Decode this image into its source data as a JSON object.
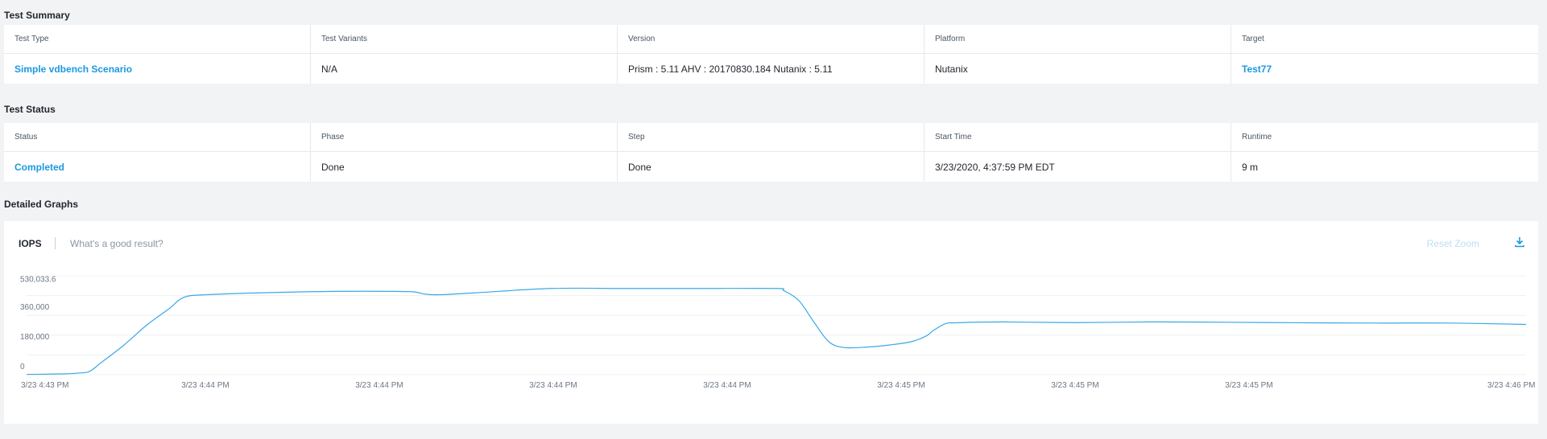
{
  "sections": {
    "summary_title": "Test Summary",
    "status_title": "Test Status",
    "graphs_title": "Detailed Graphs"
  },
  "summary": {
    "headers": [
      "Test Type",
      "Test Variants",
      "Version",
      "Platform",
      "Target"
    ],
    "values": [
      "Simple vdbench Scenario",
      "N/A",
      "Prism : 5.11 AHV : 20170830.184 Nutanix : 5.11",
      "Nutanix",
      "Test77"
    ]
  },
  "status": {
    "headers": [
      "Status",
      "Phase",
      "Step",
      "Start Time",
      "Runtime"
    ],
    "values": [
      "Completed",
      "Done",
      "Done",
      "3/23/2020, 4:37:59 PM EDT",
      "9 m"
    ]
  },
  "graph": {
    "tab_label": "IOPS",
    "help_link": "What's a good result?",
    "reset_zoom": "Reset Zoom",
    "download_icon": "download-icon",
    "line_color": "#3aa8e6"
  },
  "chart_data": {
    "type": "line",
    "yticks": [
      {
        "value": 0,
        "label": "0"
      },
      {
        "value": 180000,
        "label": "180,000"
      },
      {
        "value": 360000,
        "label": "360,000"
      },
      {
        "value": 530033.6,
        "label": "530,033.6"
      }
    ],
    "ylim": [
      0,
      600000
    ],
    "xticks": [
      {
        "x": 0.0,
        "label": "3/23 4:43 PM"
      },
      {
        "x": 0.107,
        "label": "3/23 4:44 PM"
      },
      {
        "x": 0.223,
        "label": "3/23 4:44 PM"
      },
      {
        "x": 0.339,
        "label": "3/23 4:44 PM"
      },
      {
        "x": 0.455,
        "label": "3/23 4:44 PM"
      },
      {
        "x": 0.571,
        "label": "3/23 4:45 PM"
      },
      {
        "x": 0.687,
        "label": "3/23 4:45 PM"
      },
      {
        "x": 0.803,
        "label": "3/23 4:45 PM"
      },
      {
        "x": 0.978,
        "label": "3/23 4:46 PM"
      }
    ],
    "xlim": [
      0,
      1
    ],
    "series": [
      {
        "x": [
          0,
          0.025,
          0.035,
          0.042,
          0.05,
          0.065,
          0.08,
          0.095,
          0.105,
          0.12,
          0.15,
          0.2,
          0.25,
          0.26,
          0.265,
          0.275,
          0.3,
          0.35,
          0.4,
          0.45,
          0.5,
          0.505,
          0.515,
          0.525,
          0.535,
          0.545,
          0.56,
          0.575,
          0.59,
          0.6,
          0.605,
          0.613,
          0.62,
          0.65,
          0.7,
          0.75,
          0.8,
          0.85,
          0.9,
          0.95,
          1.0
        ],
        "values": [
          1500,
          5000,
          10000,
          20000,
          75000,
          180000,
          300000,
          400000,
          470000,
          485000,
          495000,
          505000,
          505000,
          500000,
          490000,
          485000,
          497000,
          523000,
          523000,
          523000,
          523000,
          510000,
          450000,
          320000,
          200000,
          165000,
          167000,
          180000,
          200000,
          235000,
          270000,
          310000,
          315000,
          320000,
          316000,
          320000,
          318000,
          315000,
          313000,
          313000,
          305000
        ]
      }
    ]
  }
}
